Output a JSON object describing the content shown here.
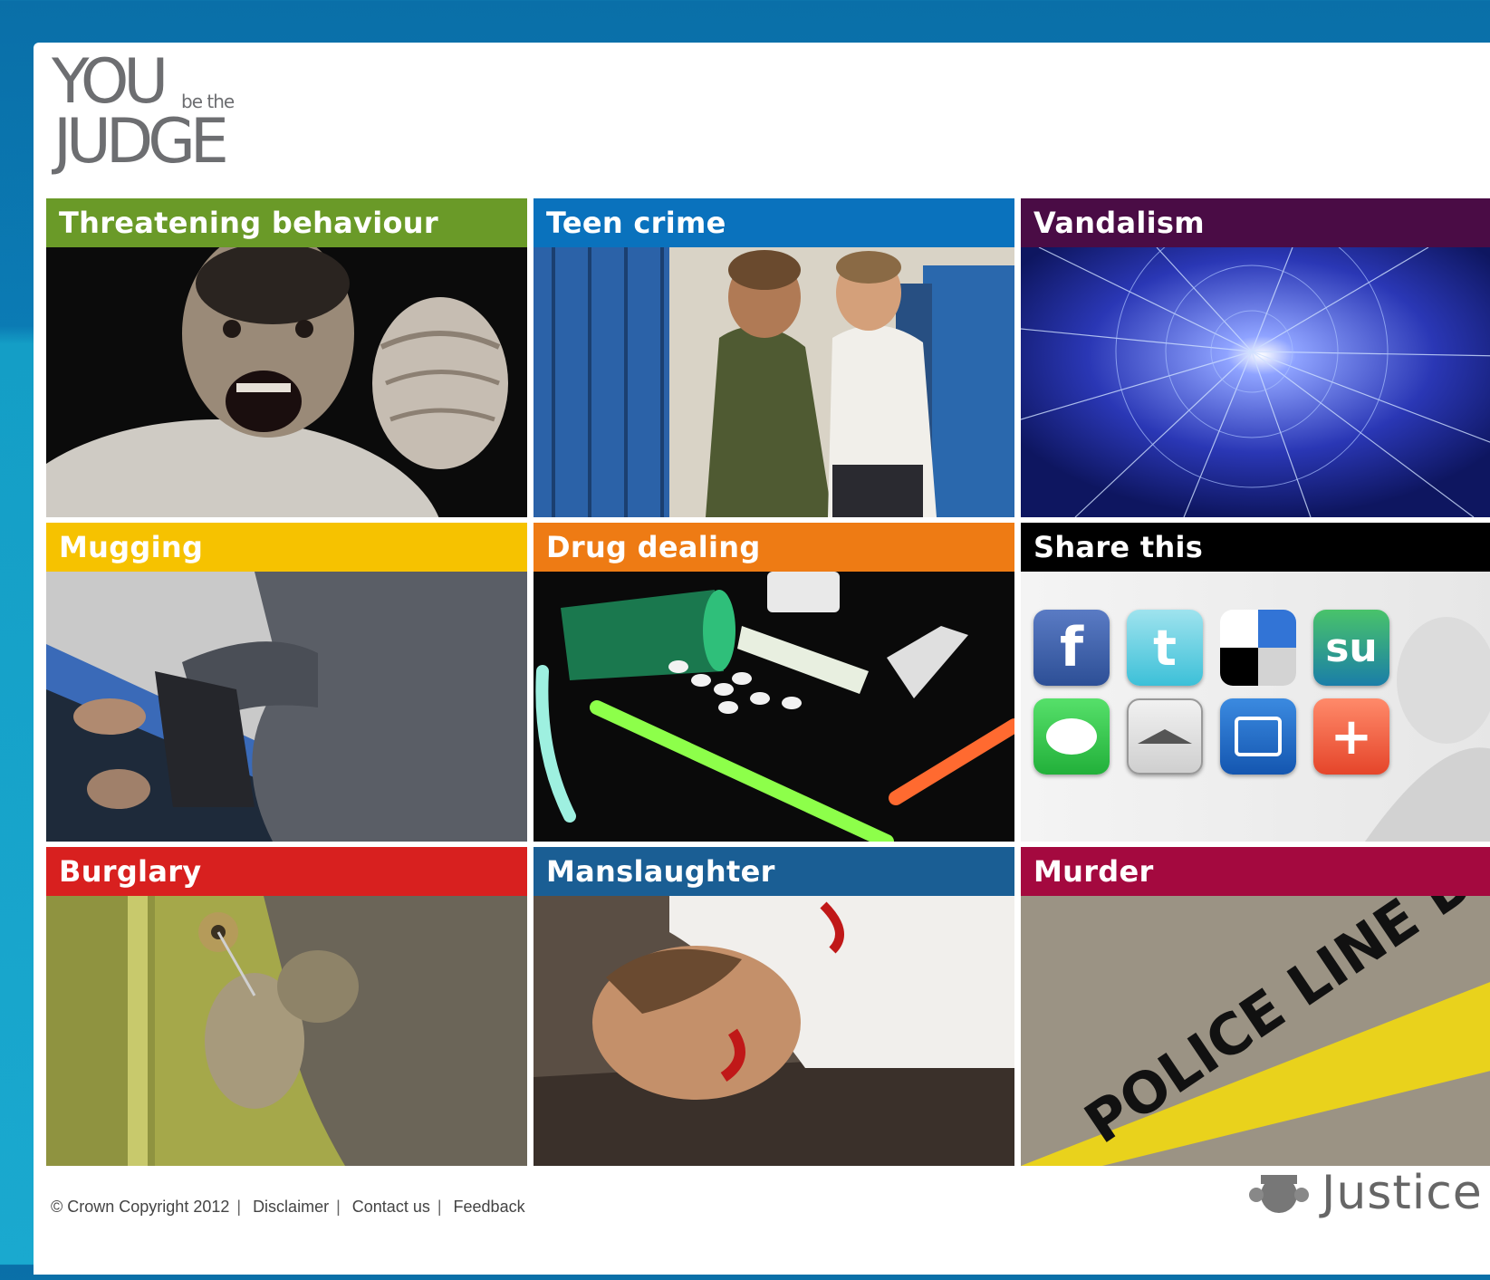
{
  "logo": {
    "you": "YOU",
    "be_the": "be the",
    "judge": "JUDGE"
  },
  "tiles": [
    {
      "title": "Threatening behaviour",
      "color": "#6a9a28"
    },
    {
      "title": "Teen crime",
      "color": "#0a72bd"
    },
    {
      "title": "Vandalism",
      "color": "#4a0c45"
    },
    {
      "title": "Mugging",
      "color": "#f6c200"
    },
    {
      "title": "Drug dealing",
      "color": "#ee7b14"
    },
    {
      "title": "Share this",
      "color": "#000000"
    },
    {
      "title": "Burglary",
      "color": "#d8201f"
    },
    {
      "title": "Manslaughter",
      "color": "#1a5e94"
    },
    {
      "title": "Murder",
      "color": "#a4093f"
    }
  ],
  "share_icons": [
    {
      "icon": "facebook-icon",
      "glyph": "f"
    },
    {
      "icon": "twitter-icon",
      "glyph": "t"
    },
    {
      "icon": "delicious-icon",
      "glyph": ""
    },
    {
      "icon": "stumbleupon-icon",
      "glyph": "su"
    },
    {
      "icon": "message-icon",
      "glyph": ""
    },
    {
      "icon": "graduation-cap-icon",
      "glyph": ""
    },
    {
      "icon": "books-icon",
      "glyph": ""
    },
    {
      "icon": "add-plus-icon",
      "glyph": "+"
    }
  ],
  "police_tape": "POLICE LINE DO",
  "footer": {
    "copyright": "© Crown Copyright 2012",
    "disclaimer": "Disclaimer",
    "contact": "Contact us",
    "feedback": "Feedback",
    "sep": "|"
  },
  "justice": "Justice"
}
